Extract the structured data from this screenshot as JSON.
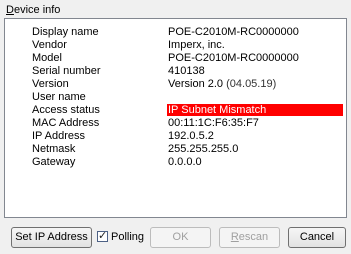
{
  "group": {
    "title": "Device info",
    "title_first": "D",
    "title_rest": "evice info"
  },
  "fields": [
    {
      "label": "Display name",
      "value": "POE-C2010M-RC0000000"
    },
    {
      "label": "Vendor",
      "value": "Imperx, inc."
    },
    {
      "label": "Model",
      "value": "POE-C2010M-RC0000000"
    },
    {
      "label": "Serial number",
      "value": "410138"
    },
    {
      "label": "Version",
      "value": "Version 2.0",
      "extra": "(04.05.19)"
    },
    {
      "label": "User name",
      "value": ""
    },
    {
      "label": "Access status",
      "value": "IP Subnet Mismatch"
    },
    {
      "label": "MAC Address",
      "value": "00:11:1C:F6:35:F7"
    },
    {
      "label": "IP Address",
      "value": "192.0.5.2"
    },
    {
      "label": "Netmask",
      "value": "255.255.255.0"
    },
    {
      "label": "Gateway",
      "value": "0.0.0.0"
    }
  ],
  "buttons": {
    "set_ip": "Set IP Address",
    "polling_label": "Polling",
    "polling_checked": true,
    "ok": "OK",
    "rescan_first": "R",
    "rescan_rest": "escan",
    "cancel": "Cancel"
  },
  "colors": {
    "mismatch_bg": "#ff0000",
    "mismatch_text": "#ffffff"
  }
}
